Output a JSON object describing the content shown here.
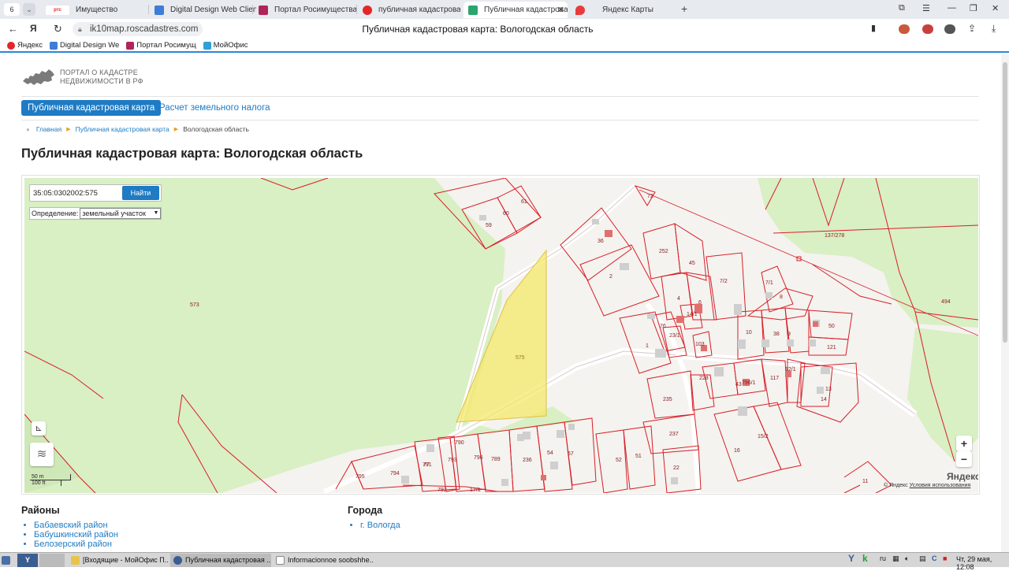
{
  "browser": {
    "tab_counter": "6",
    "tabs": [
      {
        "label": "Имущество",
        "favicon": "ртс",
        "color": "#e3262a"
      },
      {
        "label": "Digital Design Web Client",
        "color": "#3b7dd8"
      },
      {
        "label": "Портал Росимущества",
        "color": "#b0245c"
      },
      {
        "label": "публичная кадастровая",
        "color": "#e3262a"
      },
      {
        "label": "Публичная кадастрова",
        "color": "#2aa56b",
        "active": true
      },
      {
        "label": "Яндекс Карты",
        "color": "#e93b3b"
      }
    ],
    "url": "ik10map.roscadastres.com",
    "page_title": "Публичная кадастровая карта: Вологодская область",
    "bookmarks": [
      {
        "label": "Яндекс",
        "color": "#e3262a"
      },
      {
        "label": "Digital Design We",
        "color": "#3b7dd8"
      },
      {
        "label": "Портал Росимущ",
        "color": "#b0245c"
      },
      {
        "label": "МойОфис",
        "color": "#2fa0d8"
      }
    ]
  },
  "site": {
    "logo_line1": "ПОРТАЛ О КАДАСТРЕ",
    "logo_line2": "НЕДВИЖИМОСТИ В РФ",
    "nav_active": "Публичная кадастровая карта",
    "nav_other": "Расчет земельного налога",
    "breadcrumbs": [
      "Главная",
      "Публичная кадастровая карта",
      "Вологодская область"
    ],
    "heading": "Публичная кадастровая карта: Вологодская область"
  },
  "map": {
    "search_value": "35:05:0302002:575",
    "search_button": "Найти",
    "definition_label": "Определение:",
    "definition_value": "земельный участок",
    "zoom_in": "+",
    "zoom_out": "−",
    "scale_metric": "50 m",
    "scale_imperial": "100 ft",
    "yandex_logo_main": "Яндекс",
    "terms_prefix": "© Яндекс",
    "terms_link": "Условия использования",
    "selected_parcel_label": "575",
    "parcel_labels": [
      "573",
      "59",
      "60",
      "61",
      "36",
      "72",
      "2",
      "252",
      "45",
      "137/278",
      "7/2",
      "7/1",
      "4",
      "6",
      "8",
      "494",
      "1",
      "76",
      "23/1",
      "14/1",
      "103",
      "10",
      "38",
      "9",
      "50",
      "121",
      "575",
      "228",
      "43",
      "117",
      "12/1",
      "14",
      "13",
      "235",
      "237",
      "16",
      "15/2",
      "22",
      "52",
      "51",
      "236",
      "54",
      "57",
      "790",
      "789",
      "796",
      "791",
      "793",
      "794",
      "795",
      "792",
      "17/1",
      "796/1",
      "77",
      "11"
    ]
  },
  "regions": {
    "title": "Районы",
    "items": [
      "Бабаевский район",
      "Бабушкинский район",
      "Белозерский район"
    ]
  },
  "cities": {
    "title": "Города",
    "items": [
      "г. Вологда"
    ]
  },
  "taskbar": {
    "items": [
      "[Входящие - МойОфис П...",
      "Публичная кадастровая ...",
      "Informacionnoe soobshhe..."
    ],
    "lang": "ru",
    "clock": "Чт, 29 мая, 12:08"
  }
}
